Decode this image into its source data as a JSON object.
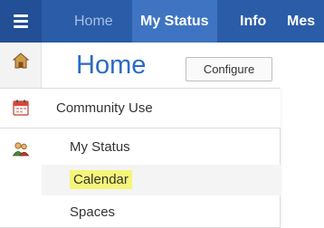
{
  "topnav": {
    "menu_icon": "hamburger-menu-icon",
    "items": [
      {
        "label": "Home",
        "state": "dimmed"
      },
      {
        "label": "My Status",
        "state": "active"
      },
      {
        "label": "Info",
        "state": "normal"
      },
      {
        "label": "Mes",
        "state": "normal"
      }
    ]
  },
  "sidebar": {
    "icons": [
      "home-icon",
      "calendar-icon",
      "people-icon"
    ]
  },
  "page": {
    "title": "Home",
    "configure_label": "Configure"
  },
  "dropdown": {
    "header_icon": "calendar-icon",
    "header_label": "Community Use",
    "items": [
      {
        "label": "My Status",
        "highlighted": false
      },
      {
        "label": "Calendar",
        "highlighted": true
      },
      {
        "label": "Spaces",
        "highlighted": false
      }
    ]
  },
  "colors": {
    "nav_background": "#2a5ca8",
    "nav_active": "#3e74c1",
    "title_blue": "#2a6bc4",
    "highlight_yellow": "#f5f57a"
  }
}
